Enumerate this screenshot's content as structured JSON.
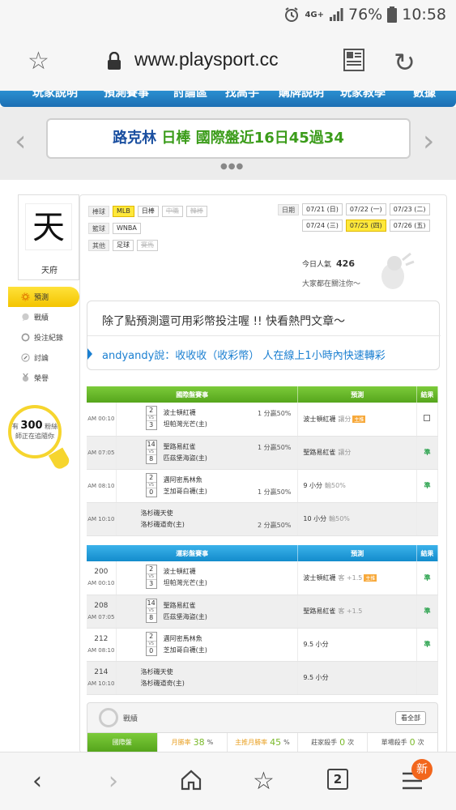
{
  "statusbar": {
    "network": "4G+",
    "battery": "76%",
    "time": "10:58"
  },
  "browser": {
    "url": "www.playsport.cc"
  },
  "site_nav": {
    "items": [
      "玩家說明",
      "預測賽事",
      "討論區",
      "找高手",
      "購牌說明",
      "玩家教學",
      "數據"
    ]
  },
  "banner": {
    "part1": "路克林",
    "part2": "日棒",
    "part3": "國際盤近16日45過34",
    "dots": "●●●"
  },
  "user": {
    "avatar_char": "天",
    "name": "天府"
  },
  "sidemenu": {
    "items": [
      {
        "label": "預測",
        "icon": "gear-icon",
        "active": true
      },
      {
        "label": "戰績",
        "icon": "chat-icon",
        "active": false
      },
      {
        "label": "投注紀錄",
        "icon": "circle-icon",
        "active": false
      },
      {
        "label": "討論",
        "icon": "edit-icon",
        "active": false
      },
      {
        "label": "榮譽",
        "icon": "medal-icon",
        "active": false
      }
    ]
  },
  "fans": {
    "prefix": "有",
    "count": "300",
    "suffix": "粉絲",
    "line2": "師正在追隨你"
  },
  "filters": {
    "baseball_label": "棒球",
    "baseball": [
      "MLB",
      "日棒",
      "中職",
      "韓棒"
    ],
    "basketball_label": "籃球",
    "basketball": [
      "WNBA"
    ],
    "other_label": "其他",
    "other": [
      "足球",
      "賽馬"
    ]
  },
  "dates": {
    "label": "日期",
    "row1": [
      "07/21 (日)",
      "07/22 (一)",
      "07/23 (二)"
    ],
    "row2": [
      "07/24 (三)",
      "07/25 (四)",
      "07/26 (五)"
    ]
  },
  "stats": {
    "popularity_label": "今日人氣",
    "popularity": "426",
    "follow_text": "大家都在關注你～"
  },
  "notice": {
    "line1": "除了點預測還可用彩幣投注喔 !! 快看熱門文章～",
    "line2": "andyandy說：收收收（收彩幣） 人在線上1小時內快速轉彩"
  },
  "intl_table": {
    "headers": [
      "國際盤賽事",
      "預測",
      "結果"
    ],
    "rows": [
      {
        "time": "AM 00:10",
        "s1": "2",
        "s2": "3",
        "vs": "VS",
        "team1": "波士頓紅襪",
        "team2": "坦帕灣光芒(主)",
        "odds": "1 分贏50%",
        "pred": "波士頓紅襪",
        "pred_sub": "讓分",
        "badge": "主推",
        "result": ""
      },
      {
        "time": "AM 07:05",
        "s1": "14",
        "s2": "8",
        "vs": "VS",
        "team1": "聖路易紅雀",
        "team2": "匹茲堡海盜(主)",
        "odds": "1 分贏50%",
        "pred": "聖路易紅雀",
        "pred_sub": "讓分",
        "badge": "",
        "result": "準"
      },
      {
        "time": "AM 08:10",
        "s1": "2",
        "s2": "0",
        "vs": "VS",
        "team1": "邁阿密馬林魚",
        "team2": "芝加哥白襪(主)",
        "odds": "1 分贏50%",
        "pred": "9 小分",
        "pred_sub": "輸50%",
        "badge": "",
        "result": "準"
      },
      {
        "time": "AM 10:10",
        "s1": "",
        "s2": "",
        "vs": "",
        "team1": "洛杉磯天使",
        "team2": "洛杉磯道奇(主)",
        "odds": "2 分贏50%",
        "pred": "10 小分",
        "pred_sub": "輸50%",
        "badge": "",
        "result": ""
      }
    ]
  },
  "lottery_table": {
    "headers": [
      "運彩盤賽事",
      "預測",
      "結果"
    ],
    "rows": [
      {
        "gno": "200",
        "time": "AM 00:10",
        "s1": "2",
        "s2": "3",
        "vs": "VS",
        "team1": "波士頓紅襪",
        "team2": "坦帕灣光芒(主)",
        "pred": "波士頓紅襪",
        "pred_sub": "客 +1.5",
        "badge": "主推",
        "result": "準"
      },
      {
        "gno": "208",
        "time": "AM 07:05",
        "s1": "14",
        "s2": "8",
        "vs": "VS",
        "team1": "聖路易紅雀",
        "team2": "匹茲堡海盜(主)",
        "pred": "聖路易紅雀",
        "pred_sub": "客 +1.5",
        "badge": "",
        "result": "準"
      },
      {
        "gno": "212",
        "time": "AM 08:10",
        "s1": "2",
        "s2": "0",
        "vs": "VS",
        "team1": "邁阿密馬林魚",
        "team2": "芝加哥白襪(主)",
        "pred": "9.5 小分",
        "pred_sub": "",
        "badge": "",
        "result": "準"
      },
      {
        "gno": "214",
        "time": "AM 10:10",
        "s1": "",
        "s2": "",
        "vs": "",
        "team1": "洛杉磯天使",
        "team2": "洛杉磯道奇(主)",
        "pred": "9.5 小分",
        "pred_sub": "",
        "badge": "",
        "result": ""
      }
    ]
  },
  "record": {
    "title": "戰績",
    "view_all": "看全部",
    "items": [
      {
        "label": "國際盤",
        "value": "",
        "unit": ""
      },
      {
        "label": "月勝率",
        "value": "38",
        "unit": "%"
      },
      {
        "label": "主推月勝率",
        "value": "45",
        "unit": "%"
      },
      {
        "label": "莊家殺手",
        "value": "0",
        "unit": "次"
      },
      {
        "label": "單場殺手",
        "value": "0",
        "unit": "次"
      }
    ]
  },
  "toolbar": {
    "tabs_count": "2",
    "new_badge": "新"
  },
  "colors": {
    "accent_green": "#55a51c",
    "accent_blue": "#138ccc",
    "yellow": "#ffe23a"
  }
}
